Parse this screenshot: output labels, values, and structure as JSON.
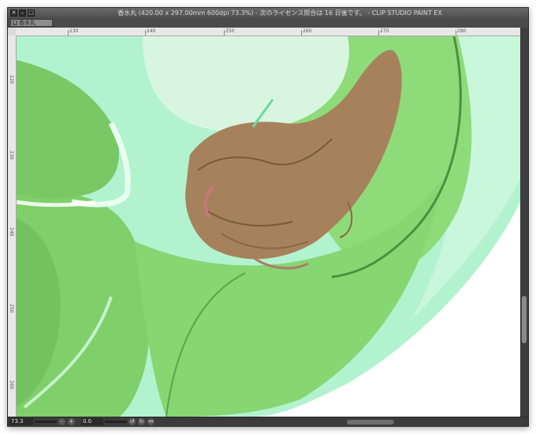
{
  "window": {
    "title": "香水丸 (420.00 x 297.00mm 600dpi 73.3%)  - 次のライセンス照合は 16 日後です。 - CLIP STUDIO PAINT EX"
  },
  "tabs": [
    {
      "label": "香水丸"
    }
  ],
  "ruler": {
    "horizontal_labels": [
      "230",
      "240",
      "250",
      "260",
      "270",
      "280"
    ],
    "vertical_labels": [
      "220",
      "230",
      "240",
      "250",
      "260"
    ]
  },
  "status": {
    "zoom": "73.3",
    "angle": "0.0"
  },
  "icons": {
    "close": "close-icon",
    "minimize": "minimize-icon",
    "maximize": "maximize-icon"
  },
  "colors": {
    "canvas_green": "#8fd97a",
    "hair_brown": "#a8825e",
    "mint": "#bff0d2"
  }
}
